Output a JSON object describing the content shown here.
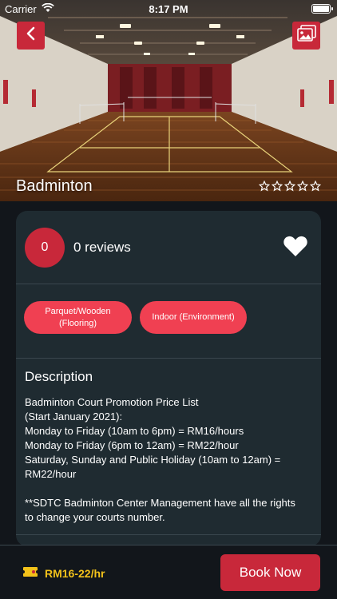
{
  "status": {
    "carrier": "Carrier",
    "time": "8:17 PM"
  },
  "hero": {
    "title": "Badminton",
    "rating": 0,
    "max_rating": 5
  },
  "reviews": {
    "count": "0",
    "label": "0 reviews"
  },
  "tags": [
    {
      "label": "Parquet/Wooden\n(Flooring)"
    },
    {
      "label": "Indoor (Environment)"
    }
  ],
  "description": {
    "title": "Description",
    "body": "Badminton Court Promotion Price List\n(Start January 2021):\nMonday to Friday (10am to 6pm) = RM16/hours\nMonday to Friday (6pm to 12am) = RM22/hour\nSaturday, Sunday and Public Holiday (10am to 12am) = RM22/hour\n\n**SDTC Badminton Center Management have all the rights to change your courts number."
  },
  "footer": {
    "price": "RM16-22/hr",
    "book_label": "Book Now"
  },
  "colors": {
    "accent": "#c8283a",
    "tag": "#f04052",
    "price": "#f3c21a",
    "card": "#1f2b31",
    "background": "#12161b"
  },
  "icons": {
    "back": "chevron-left-icon",
    "gallery": "image-gallery-icon",
    "favorite": "heart-icon",
    "price": "ticket-icon",
    "wifi": "wifi-icon",
    "battery": "battery-icon",
    "star": "star-outline-icon"
  }
}
